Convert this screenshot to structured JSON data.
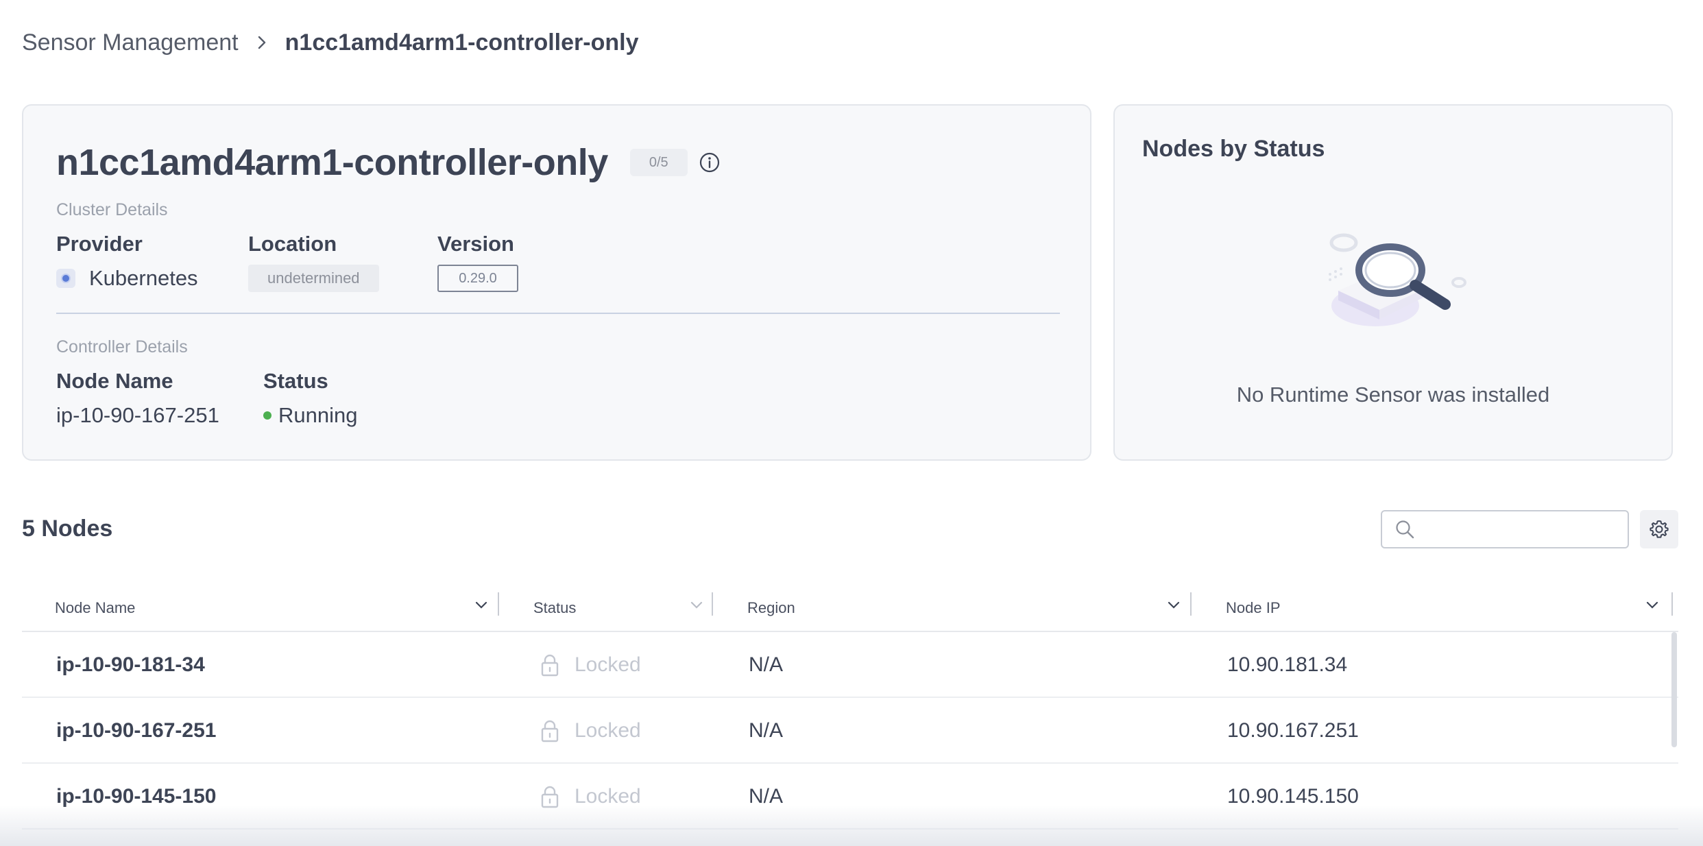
{
  "breadcrumb": {
    "parent": "Sensor Management",
    "current": "n1cc1amd4arm1-controller-only"
  },
  "cluster": {
    "title": "n1cc1amd4arm1-controller-only",
    "node_count_badge": "0/5",
    "cluster_details_label": "Cluster Details",
    "provider_label": "Provider",
    "provider_value": "Kubernetes",
    "location_label": "Location",
    "location_value": "undetermined",
    "version_label": "Version",
    "version_value": "0.29.0",
    "controller_details_label": "Controller Details",
    "node_name_label": "Node Name",
    "node_name_value": "ip-10-90-167-251",
    "status_label": "Status",
    "status_value": "Running"
  },
  "nodes_by_status": {
    "title": "Nodes by Status",
    "empty_message": "No Runtime Sensor was installed"
  },
  "nodes_table": {
    "heading": "5 Nodes",
    "search_placeholder": "",
    "columns": [
      "Node Name",
      "Status",
      "Region",
      "Node IP"
    ],
    "rows": [
      {
        "name": "ip-10-90-181-34",
        "status": "Locked",
        "region": "N/A",
        "ip": "10.90.181.34"
      },
      {
        "name": "ip-10-90-167-251",
        "status": "Locked",
        "region": "N/A",
        "ip": "10.90.167.251"
      },
      {
        "name": "ip-10-90-145-150",
        "status": "Locked",
        "region": "N/A",
        "ip": "10.90.145.150"
      }
    ]
  },
  "colors": {
    "running_status": "#4caf50",
    "locked_text": "#c3c7d0",
    "card_background": "#f7f8fa"
  }
}
